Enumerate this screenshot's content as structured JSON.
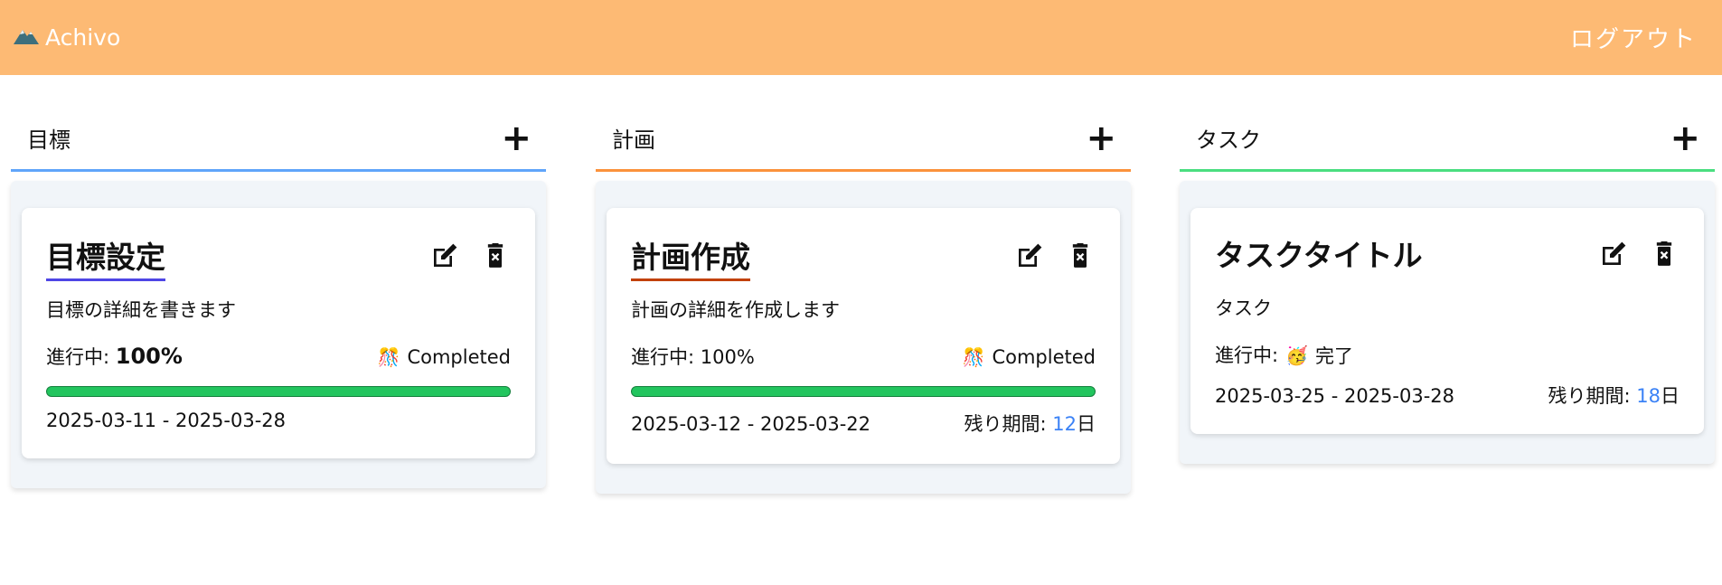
{
  "header": {
    "app_name": "Achivo",
    "logout_label": "ログアウト",
    "color": "#fdba74"
  },
  "columns": [
    {
      "title": "目標",
      "accent": "#60a5fa",
      "card": {
        "title": "目標設定",
        "title_underline": "#4f46e5",
        "description": "目標の詳細を書きます",
        "progress_label": "進行中:",
        "progress_value": "100%",
        "progress": 1.0,
        "status_emoji": "🎊",
        "status": "Completed",
        "date_range": "2025-03-11 - 2025-03-28"
      }
    },
    {
      "title": "計画",
      "accent": "#fb923c",
      "card": {
        "title": "計画作成",
        "title_underline": "#c2410c",
        "description": "計画の詳細を作成します",
        "progress_text": "進行中: 100%",
        "progress": 1.0,
        "status_emoji": "🎊",
        "status": "Completed",
        "date_range": "2025-03-12 - 2025-03-22",
        "remaining_label": "残り期間: ",
        "remaining_days": "12",
        "remaining_unit": "日"
      }
    },
    {
      "title": "タスク",
      "accent": "#4ade80",
      "card": {
        "title": "タスクタイトル",
        "description": "タスク",
        "progress_label": "進行中:",
        "status_emoji": "🥳",
        "status": "完了",
        "date_range": "2025-03-25 - 2025-03-28",
        "remaining_label": "残り期間: ",
        "remaining_days": "18",
        "remaining_unit": "日"
      }
    }
  ]
}
